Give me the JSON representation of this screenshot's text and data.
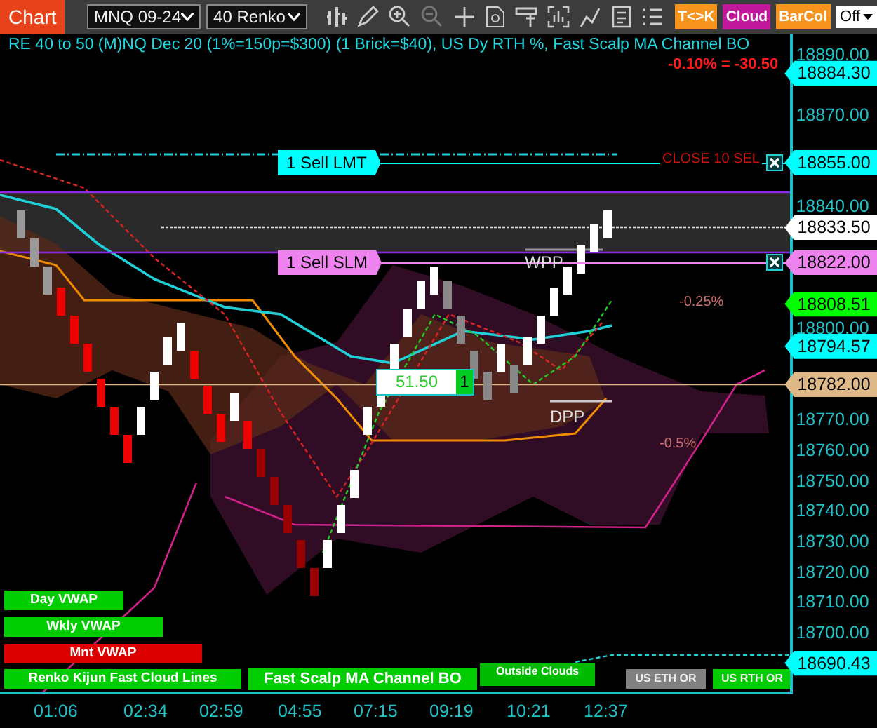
{
  "toolbar": {
    "title": "Chart",
    "instrument": "MNQ 09-24",
    "bar_type": "40 Renko",
    "toggles": [
      {
        "label": "T<>K",
        "color": "#f7941d"
      },
      {
        "label": "Cloud",
        "color": "#c0189a"
      },
      {
        "label": "BarCol",
        "color": "#f7941d"
      }
    ],
    "mode": "Off"
  },
  "chart": {
    "title": "RE 40 to 50 (M)NQ Dec 20 (1%=150p=$300) (1 Brick=$40), US Dy RTH %, Fast Scalp MA Channel BO",
    "pnl": "-0.10% = -30.50",
    "price_ticks": [
      "18890.00",
      "18870.00",
      "18840.00",
      "18800.00",
      "18770.00",
      "18760.00",
      "18750.00",
      "18740.00",
      "18730.00",
      "18720.00",
      "18710.00",
      "18700.00"
    ],
    "price_markers": [
      {
        "price": "18884.30",
        "color": "#00ffff"
      },
      {
        "price": "18855.00",
        "color": "#00ffff",
        "order": "1 Sell LMT",
        "note": "CLOSE 10 SEL"
      },
      {
        "price": "18833.50",
        "color": "#ffffff"
      },
      {
        "price": "18822.00",
        "color": "#ee82ee",
        "order": "1 Sell SLM"
      },
      {
        "price": "18808.51",
        "color": "#00ff00"
      },
      {
        "price": "18794.57",
        "color": "#00ffff"
      },
      {
        "price": "18782.00",
        "color": "#deb887"
      },
      {
        "price": "18690.43",
        "color": "#00ffff"
      }
    ],
    "annotations": [
      "WPP",
      "DPP",
      "-0.25%",
      "-0.5%"
    ],
    "position": {
      "pnl": "51.50",
      "quantity": "1"
    },
    "legend": [
      {
        "label": "Day VWAP",
        "color": "#00cc00"
      },
      {
        "label": "Wkly VWAP",
        "color": "#00cc00"
      },
      {
        "label": "Mnt VWAP",
        "color": "#dd0000"
      },
      {
        "label": "Renko Kijun Fast Cloud Lines",
        "color": "#00cc00"
      },
      {
        "label": "Outside Clouds",
        "color": "#00bb00"
      },
      {
        "label": "Fast Scalp MA Channel BO",
        "color": "#00cc00"
      },
      {
        "label": "US ETH OR",
        "color": "#808080"
      },
      {
        "label": "US RTH OR",
        "color": "#00cc00"
      }
    ],
    "time_ticks": [
      "01:06",
      "02:34",
      "02:59",
      "04:55",
      "07:15",
      "09:19",
      "10:21",
      "12:37"
    ]
  }
}
